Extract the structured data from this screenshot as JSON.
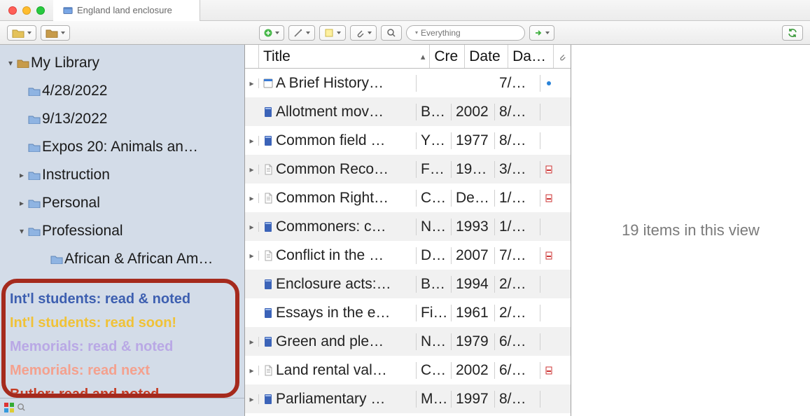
{
  "titlebar": {
    "tab_title": "England land enclosure"
  },
  "toolbar": {
    "search_placeholder": "Everything"
  },
  "sidebar": {
    "items": [
      {
        "label": "My Library",
        "depth": 0,
        "expand": "open",
        "icon": "library"
      },
      {
        "label": "4/28/2022",
        "depth": 1,
        "expand": "",
        "icon": "folder"
      },
      {
        "label": "9/13/2022",
        "depth": 1,
        "expand": "",
        "icon": "folder"
      },
      {
        "label": "Expos 20: Animals an…",
        "depth": 1,
        "expand": "",
        "icon": "folder"
      },
      {
        "label": "Instruction",
        "depth": 1,
        "expand": "closed",
        "icon": "folder"
      },
      {
        "label": "Personal",
        "depth": 1,
        "expand": "closed",
        "icon": "folder"
      },
      {
        "label": "Professional",
        "depth": 1,
        "expand": "open",
        "icon": "folder"
      },
      {
        "label": "African & African Am…",
        "depth": 2,
        "expand": "",
        "icon": "folder"
      }
    ],
    "tags": [
      {
        "label": "Int'l students: read & noted",
        "color": "#3d5fb0"
      },
      {
        "label": "Int'l students: read soon!",
        "color": "#f0c237"
      },
      {
        "label": "Memorials: read & noted",
        "color": "#b9a8e5"
      },
      {
        "label": "Memorials: read next",
        "color": "#f4a18e"
      },
      {
        "label": "Butler: read and noted",
        "color": "#c43b23"
      }
    ]
  },
  "columns": {
    "title": "Title",
    "creator": "Cre",
    "date": "Date",
    "date_added": "Da…"
  },
  "rows": [
    {
      "tw": "▸",
      "icon": "web",
      "title": "A Brief History…",
      "cre": "",
      "date": "",
      "da": "7/…",
      "att": "dot"
    },
    {
      "tw": "",
      "icon": "book",
      "title": "Allotment mov…",
      "cre": "B…",
      "date": "2002",
      "da": "8/…",
      "att": ""
    },
    {
      "tw": "▸",
      "icon": "book",
      "title": "Common field …",
      "cre": "Y…",
      "date": "1977",
      "da": "8/…",
      "att": ""
    },
    {
      "tw": "▸",
      "icon": "doc",
      "title": "Common Reco…",
      "cre": "F…",
      "date": "19…",
      "da": "3/…",
      "att": "pdf"
    },
    {
      "tw": "▸",
      "icon": "doc",
      "title": "Common Right…",
      "cre": "C…",
      "date": "De…",
      "da": "1/…",
      "att": "pdf"
    },
    {
      "tw": "▸",
      "icon": "book",
      "title": "Commoners: c…",
      "cre": "N…",
      "date": "1993",
      "da": "1/…",
      "att": ""
    },
    {
      "tw": "▸",
      "icon": "doc",
      "title": "Conflict in the …",
      "cre": "D…",
      "date": "2007",
      "da": "7/…",
      "att": "pdf"
    },
    {
      "tw": "",
      "icon": "book",
      "title": "Enclosure acts:…",
      "cre": "B…",
      "date": "1994",
      "da": "2/…",
      "att": ""
    },
    {
      "tw": "",
      "icon": "book",
      "title": "Essays in the e…",
      "cre": "Fi…",
      "date": "1961",
      "da": "2/…",
      "att": ""
    },
    {
      "tw": "▸",
      "icon": "book",
      "title": "Green and ple…",
      "cre": "N…",
      "date": "1979",
      "da": "6/…",
      "att": ""
    },
    {
      "tw": "▸",
      "icon": "doc",
      "title": "Land rental val…",
      "cre": "C…",
      "date": "2002",
      "da": "6/…",
      "att": "pdf"
    },
    {
      "tw": "▸",
      "icon": "book",
      "title": "Parliamentary …",
      "cre": "M…",
      "date": "1997",
      "da": "8/…",
      "att": ""
    }
  ],
  "info_pane": {
    "status": "19 items in this view"
  }
}
